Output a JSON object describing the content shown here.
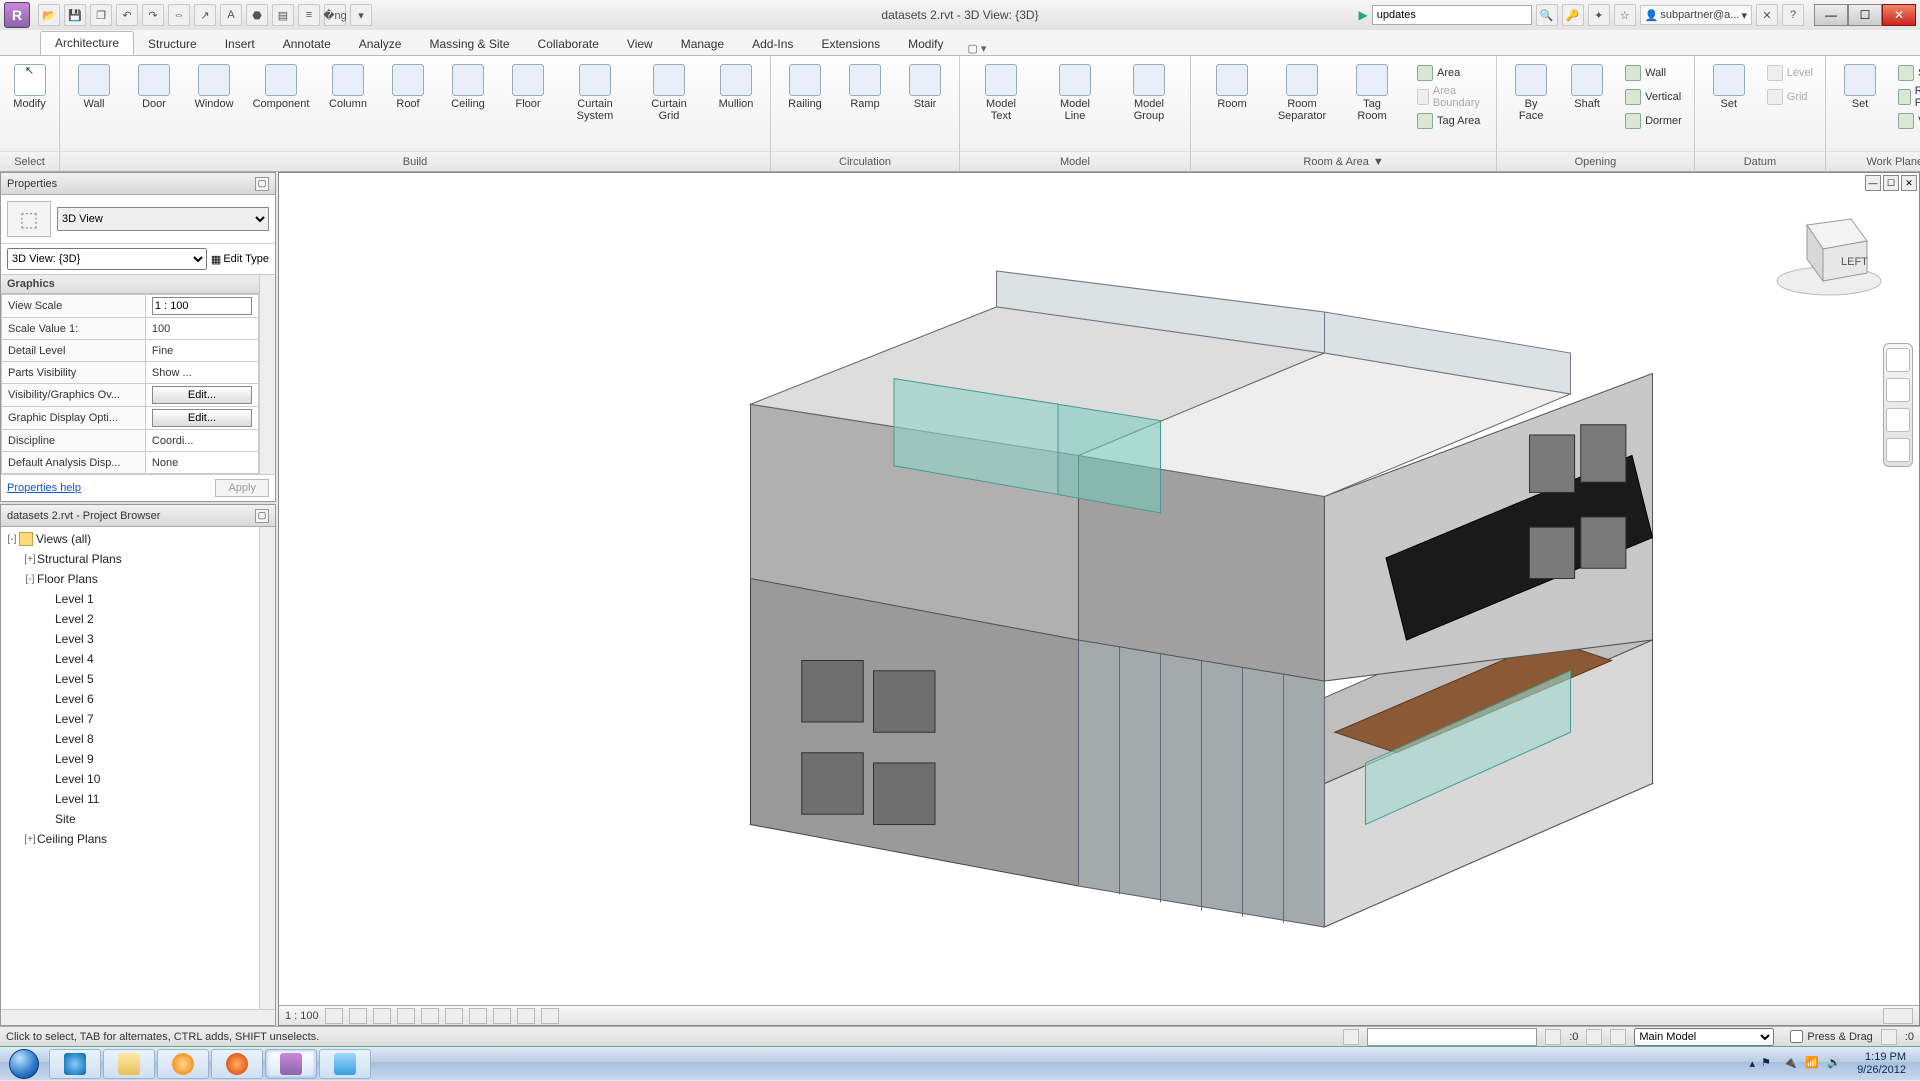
{
  "title": "datasets 2.rvt - 3D View: {3D}",
  "search_hint": "updates",
  "user": "subpartner@a...",
  "ribbon_tabs": [
    "Architecture",
    "Structure",
    "Insert",
    "Annotate",
    "Analyze",
    "Massing & Site",
    "Collaborate",
    "View",
    "Manage",
    "Add-Ins",
    "Extensions",
    "Modify"
  ],
  "ribbon_active": 0,
  "groups": {
    "select": {
      "label": "Select",
      "tools": [
        {
          "name": "Modify"
        }
      ]
    },
    "build": {
      "label": "Build",
      "tools": [
        "Wall",
        "Door",
        "Window",
        "Component",
        "Column",
        "Roof",
        "Ceiling",
        "Floor",
        "Curtain System",
        "Curtain Grid",
        "Mullion"
      ]
    },
    "circulation": {
      "label": "Circulation",
      "tools": [
        "Railing",
        "Ramp",
        "Stair"
      ]
    },
    "model": {
      "label": "Model",
      "tools": [
        "Model Text",
        "Model Line",
        "Model Group"
      ]
    },
    "room_area": {
      "label": "Room & Area",
      "big": [
        "Room",
        "Room Separator",
        "Tag Room"
      ],
      "small": [
        {
          "t": "Area",
          "d": false
        },
        {
          "t": "Area Boundary",
          "d": true
        },
        {
          "t": "Tag Area",
          "d": false
        }
      ]
    },
    "opening": {
      "label": "Opening",
      "big": [
        "By Face",
        "Shaft"
      ],
      "small": [
        "Wall",
        "Vertical",
        "Dormer"
      ]
    },
    "datum": {
      "label": "Datum",
      "big": [
        "Set"
      ],
      "small": [
        {
          "t": "Level",
          "d": true
        },
        {
          "t": "Grid",
          "d": true
        }
      ]
    },
    "workplane": {
      "label": "Work Plane",
      "big": [
        "Set"
      ],
      "small": [
        "Show",
        "Ref Plane",
        "Viewer"
      ]
    }
  },
  "properties": {
    "panel_title": "Properties",
    "type_name": "3D View",
    "instance": "3D View: {3D}",
    "edit_type": "Edit Type",
    "category": "Graphics",
    "rows": [
      {
        "k": "View Scale",
        "v": "1 : 100",
        "input": true
      },
      {
        "k": "Scale Value    1:",
        "v": "100"
      },
      {
        "k": "Detail Level",
        "v": "Fine"
      },
      {
        "k": "Parts Visibility",
        "v": "Show ..."
      },
      {
        "k": "Visibility/Graphics Ov...",
        "v": "Edit...",
        "btn": true
      },
      {
        "k": "Graphic Display Opti...",
        "v": "Edit...",
        "btn": true
      },
      {
        "k": "Discipline",
        "v": "Coordi..."
      },
      {
        "k": "Default Analysis Disp...",
        "v": "None"
      }
    ],
    "help": "Properties help",
    "apply": "Apply"
  },
  "browser": {
    "title": "datasets 2.rvt - Project Browser",
    "tree": [
      {
        "l": 0,
        "tw": "-",
        "icon": true,
        "t": "Views (all)"
      },
      {
        "l": 1,
        "tw": "+",
        "t": "Structural Plans"
      },
      {
        "l": 1,
        "tw": "-",
        "t": "Floor Plans"
      },
      {
        "l": 2,
        "t": "Level 1"
      },
      {
        "l": 2,
        "t": "Level 2"
      },
      {
        "l": 2,
        "t": "Level 3"
      },
      {
        "l": 2,
        "t": "Level 4"
      },
      {
        "l": 2,
        "t": "Level 5"
      },
      {
        "l": 2,
        "t": "Level 6"
      },
      {
        "l": 2,
        "t": "Level 7"
      },
      {
        "l": 2,
        "t": "Level 8"
      },
      {
        "l": 2,
        "t": "Level 9"
      },
      {
        "l": 2,
        "t": "Level 10"
      },
      {
        "l": 2,
        "t": "Level 11"
      },
      {
        "l": 2,
        "t": "Site"
      },
      {
        "l": 1,
        "tw": "+",
        "t": "Ceiling Plans"
      }
    ]
  },
  "viewctrl": {
    "scale": "1 : 100"
  },
  "status": {
    "hint": "Click to select, TAB for alternates, CTRL adds, SHIFT unselects.",
    "sel": ":0",
    "model": "Main Model",
    "press_drag": "Press & Drag",
    "filter": ":0"
  },
  "viewcube": {
    "face": "LEFT"
  },
  "clock": {
    "time": "1:19 PM",
    "date": "9/26/2012"
  }
}
